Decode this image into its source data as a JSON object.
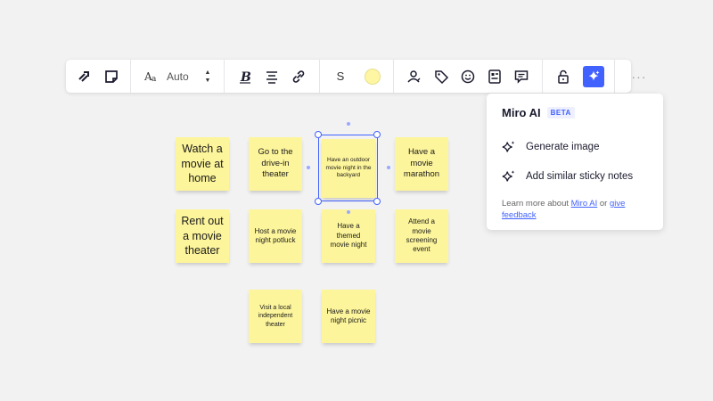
{
  "toolbar": {
    "font_size": "Auto",
    "stroke_label": "S",
    "more_label": "···",
    "colors": {
      "sticky_fill": "#fff6a3",
      "ai_accent": "#4262ff"
    }
  },
  "stickies": [
    {
      "text": "Watch a movie at home"
    },
    {
      "text": "Go to the drive-in theater"
    },
    {
      "text": "Have an outdoor movie night in the backyard"
    },
    {
      "text": "Have a movie marathon"
    },
    {
      "text": "Rent out a movie theater"
    },
    {
      "text": "Host a movie night potluck"
    },
    {
      "text": "Have a themed movie night"
    },
    {
      "text": "Attend a movie screening event"
    },
    {
      "text": "Visit a local independent theater"
    },
    {
      "text": "Have a movie night picnic"
    }
  ],
  "ai_panel": {
    "title": "Miro AI",
    "badge": "BETA",
    "items": [
      {
        "label": "Generate image",
        "icon": "sparkle-icon"
      },
      {
        "label": "Add similar sticky notes",
        "icon": "sparkle-icon"
      }
    ],
    "footer_prefix": "Learn more about ",
    "footer_link1": "Miro AI",
    "footer_mid": " or ",
    "footer_link2": "give feedback"
  }
}
